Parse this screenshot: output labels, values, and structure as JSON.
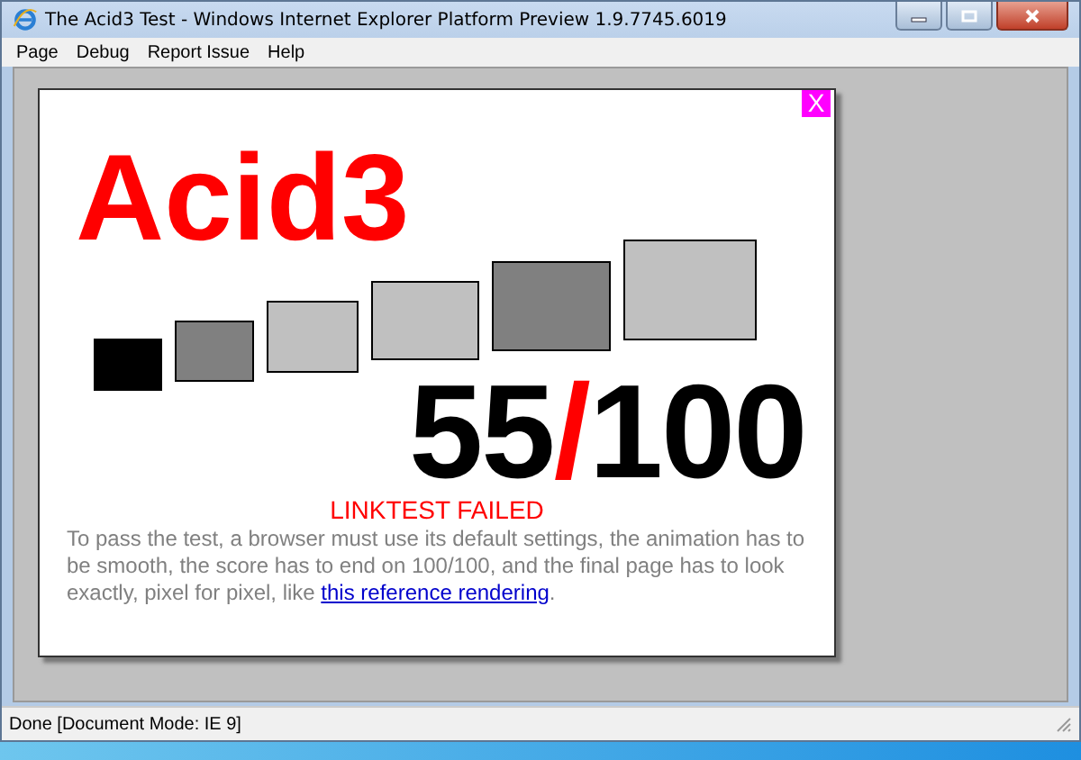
{
  "window": {
    "title": "The Acid3 Test - Windows Internet Explorer Platform Preview 1.9.7745.6019"
  },
  "menu": [
    "Page",
    "Debug",
    "Report Issue",
    "Help"
  ],
  "card": {
    "close": "X",
    "heading": "Acid3",
    "boxes": [
      {
        "color": "#000000"
      },
      {
        "color": "#808080"
      },
      {
        "color": "#c0c0c0"
      },
      {
        "color": "#c0c0c0"
      },
      {
        "color": "#808080"
      },
      {
        "color": "#c0c0c0"
      }
    ],
    "score": {
      "value": "55",
      "separator": "/",
      "total": "100"
    },
    "result": "LINKTEST FAILED",
    "instructions": "To pass the test, a browser must use its default settings, the animation has to be smooth, the score has to end on 100/100, and the final page has to look exactly, pixel for pixel, like",
    "link": "this reference rendering",
    "end": "."
  },
  "status_bar": "Done [Document Mode: IE 9]"
}
